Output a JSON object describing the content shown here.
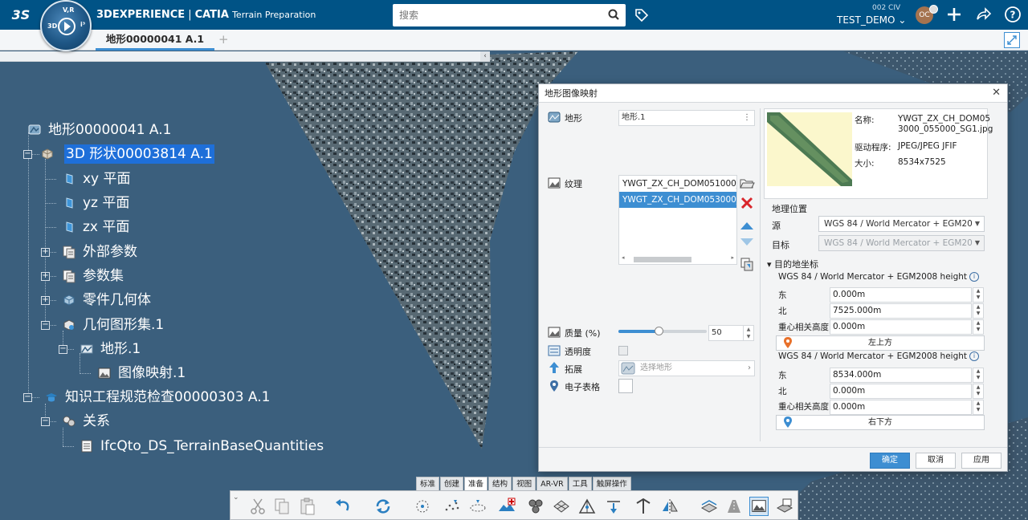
{
  "header": {
    "brand": "3DEXPERIENCE",
    "product": "CATIA",
    "app": "Terrain Preparation",
    "search_placeholder": "搜索",
    "collab_space": "002 CIV",
    "user": "TEST_DEMO",
    "user_chevron": "⌄",
    "avatar_initials": "OC",
    "compass": {
      "top": "V,R",
      "left": "3D",
      "right": "i³",
      "bottom_left": "V",
      "bottom_right": "R"
    }
  },
  "tabs": {
    "active": "地形00000041 A.1",
    "add": "+"
  },
  "panel_handle": "‹",
  "tree": {
    "root": "地形00000041 A.1",
    "items": [
      {
        "label": "3D 形状00003814 A.1",
        "selected": true,
        "expander": "−",
        "icon": "3d-shape-icon"
      },
      {
        "label": "xy 平面",
        "icon": "plane-icon"
      },
      {
        "label": "yz 平面",
        "icon": "plane-icon"
      },
      {
        "label": "zx 平面",
        "icon": "plane-icon"
      },
      {
        "label": "外部参数",
        "expander": "+",
        "icon": "parameters-icon"
      },
      {
        "label": "参数集",
        "expander": "+",
        "icon": "parameter-set-icon"
      },
      {
        "label": "零件几何体",
        "expander": "+",
        "icon": "part-body-icon"
      },
      {
        "label": "几何图形集.1",
        "expander": "−",
        "icon": "geometric-set-icon"
      },
      {
        "label": "地形.1",
        "expander": "−",
        "icon": "terrain-icon"
      },
      {
        "label": "图像映射.1",
        "icon": "image-mapping-icon"
      },
      {
        "label": "知识工程规范检查00000303 A.1",
        "expander": "−",
        "icon": "knowledge-icon"
      },
      {
        "label": "关系",
        "expander": "−",
        "icon": "relations-icon"
      },
      {
        "label": "IfcQto_DS_TerrainBaseQuantities",
        "icon": "table-icon"
      }
    ]
  },
  "dialog": {
    "title": "地形图像映射",
    "close": "✕",
    "terrain_label": "地形",
    "terrain_value": "地形.1",
    "terrain_menu": "⋮",
    "texture_label": "纹理",
    "textures": [
      "YWGT_ZX_CH_DOM051000_0",
      "YWGT_ZX_CH_DOM053000_0"
    ],
    "selected_texture": 1,
    "quality_label": "质量 (%)",
    "quality_value": "50",
    "quality_fraction": 0.45,
    "transparency_label": "透明度",
    "extend_label": "拓展",
    "extend_placeholder": "选择地形",
    "spreadsheet_label": "电子表格",
    "file": {
      "name_label": "名称:",
      "name_value": "YWGT_ZX_CH_DOM053000_055000_SG1.jpg",
      "name_line1": "YWGT_ZX_CH_DOM05",
      "name_line2": "3000_055000_SG1.jpg",
      "driver_label": "驱动程序:",
      "driver_value": "JPEG/JPEG JFIF",
      "size_label": "大小:",
      "size_value": "8534x7525"
    },
    "geo": {
      "section": "地理位置",
      "source_label": "源",
      "source_value": "WGS 84 / World Mercator +  EGM20",
      "target_label": "目标",
      "target_value": "WGS 84 / World Mercator +  EGM20",
      "dest_section": "▾ 目的地坐标",
      "crs_name": "WGS 84 / World Mercator +  EGM2008 height",
      "top_left": {
        "east": "0.000m",
        "north": "7525.000m",
        "height": "0.000m",
        "button": "左上方"
      },
      "bottom_right": {
        "east": "8534.000m",
        "north": "0.000m",
        "height": "0.000m",
        "button": "右下方"
      },
      "east_label": "东",
      "north_label": "北",
      "height_label": "重心相关高度"
    },
    "buttons": {
      "ok": "确定",
      "cancel": "取消",
      "apply": "应用"
    }
  },
  "side_arrow": "《",
  "action_bar": {
    "tabs": [
      "标准",
      "创建",
      "准备",
      "结构",
      "视图",
      "AR-VR",
      "工具",
      "触屏操作"
    ],
    "active_tab": 2,
    "collapse": "⌄"
  },
  "colors": {
    "header_bg": "#005386",
    "canvas_bg": "#3b5f7d",
    "selection": "#1e6fd9",
    "accent": "#3d8ed2"
  }
}
